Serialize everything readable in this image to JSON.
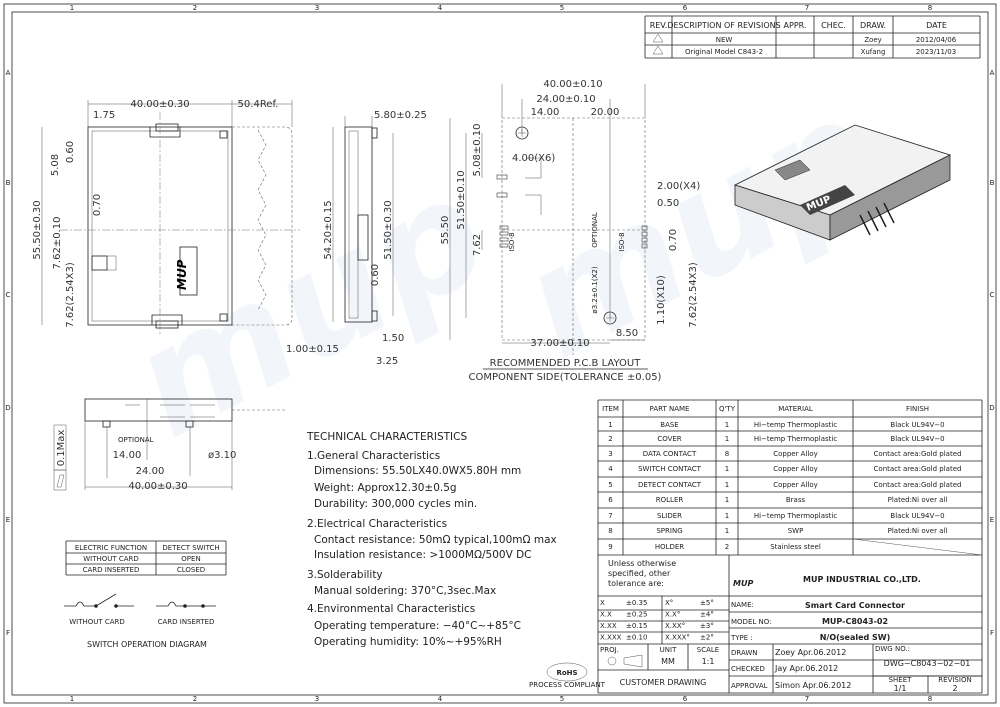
{
  "frame": {
    "columns": [
      "1",
      "2",
      "3",
      "4",
      "5",
      "6",
      "7",
      "8"
    ],
    "rows": [
      "A",
      "B",
      "C",
      "D",
      "E",
      "F"
    ]
  },
  "revisions": {
    "headers": [
      "REV.",
      "DESCRIPTION OF REVISIONS",
      "APPR.",
      "CHEC.",
      "DRAW.",
      "DATE"
    ],
    "rows": [
      {
        "rev_icon": "revision-1-triangle-icon",
        "description": "NEW",
        "appr": "",
        "chec": "",
        "draw": "Zoey",
        "date": "2012/04/06"
      },
      {
        "rev_icon": "revision-2-triangle-icon",
        "description": "Original Model C843-2",
        "appr": "",
        "chec": "",
        "draw": "Xufang",
        "date": "2023/11/03"
      }
    ]
  },
  "top_view": {
    "dims": [
      "40.00±0.30",
      "50.4Ref.",
      "1.75",
      "55.50±0.30",
      "5.08",
      "0.60",
      "0.70",
      "7.62±0.10",
      "7.62(2.54X3)"
    ],
    "logo": "MUP"
  },
  "side_view": {
    "dims": [
      "5.80±0.25",
      "54.20±0.15",
      "51.50±0.30",
      "0.60",
      "1.50",
      "1.00±0.15",
      "3.25"
    ]
  },
  "pcb_layout": {
    "dims": [
      "40.00±0.10",
      "24.00±0.10",
      "14.00",
      "20.00",
      "4.00(X6)",
      "2.00(X4)",
      "0.50",
      "55.50",
      "51.50±0.10",
      "5.08±0.10",
      "7.62",
      "OPTIONAL",
      "ø3.2±0.1(X2)",
      "ISO-8",
      "ISO-8",
      "0.70",
      "1.10(X10)",
      "7.62(2.54X3)",
      "8.50",
      "37.00±0.10"
    ],
    "caption_1": "RECOMMENDED P.C.B LAYOUT",
    "caption_2": "COMPONENT SIDE(TOLERANCE ±0.05)"
  },
  "front_view": {
    "dims": [
      "OPTIONAL",
      "14.00",
      "ø3.10",
      "24.00",
      "40.00±0.30",
      "0.1Max"
    ]
  },
  "technical": {
    "title": "TECHNICAL CHARACTERISTICS",
    "lines": [
      "1.General Characteristics",
      "Dimensions: 55.50LX40.0WX5.80H  mm",
      "Weight: Approx12.30±0.5g",
      "Durability: 300,000  cycles  min.",
      "2.Electrical Characteristics",
      "Contact resistance: 50mΩ typical,100mΩ max",
      "Insulation resistance: >1000MΩ/500V DC",
      "3.Solderability",
      "Manual soldering: 370°C,3sec.Max",
      "4.Environmental Characteristics",
      "Operating temperature: −40°C~+85°C",
      "Operating humidity: 10%~+95%RH"
    ]
  },
  "switch_table": {
    "headers": [
      "ELECTRIC FUNCTION",
      "DETECT SWITCH"
    ],
    "rows": [
      [
        "WITHOUT CARD",
        "OPEN"
      ],
      [
        "CARD INSERTED",
        "CLOSED"
      ]
    ],
    "diagram_labels": [
      "WITHOUT CARD",
      "CARD INSERTED"
    ],
    "caption": "SWITCH OPERATION DIAGRAM"
  },
  "parts": {
    "headers": [
      "ITEM",
      "PART NAME",
      "Q'TY",
      "MATERIAL",
      "FINISH"
    ],
    "rows": [
      [
        "1",
        "BASE",
        "1",
        "Hi−temp Thermoplastic",
        "Black UL94V−0"
      ],
      [
        "2",
        "COVER",
        "1",
        "Hi−temp Thermoplastic",
        "Black UL94V−0"
      ],
      [
        "3",
        "DATA CONTACT",
        "8",
        "Copper Alloy",
        "Contact area:Gold plated"
      ],
      [
        "4",
        "SWITCH CONTACT",
        "1",
        "Copper Alloy",
        "Contact area:Gold plated"
      ],
      [
        "5",
        "DETECT CONTACT",
        "1",
        "Copper Alloy",
        "Contact area:Gold plated"
      ],
      [
        "6",
        "ROLLER",
        "1",
        "Brass",
        "Plated:Ni over all"
      ],
      [
        "7",
        "SLIDER",
        "1",
        "Hi−temp Thermoplastic",
        "Black UL94V−0"
      ],
      [
        "8",
        "SPRING",
        "1",
        "SWP",
        "Plated:Ni over all"
      ],
      [
        "9",
        "HOLDER",
        "2",
        "Stainless steel",
        ""
      ]
    ]
  },
  "title_block": {
    "tolerance_note": [
      "Unless otherwise",
      "specified, other",
      "tolerance are:"
    ],
    "tolerances": [
      [
        "X",
        "±0.35",
        "X°",
        "±5°"
      ],
      [
        "X.X",
        "±0.25",
        "X.X°",
        "±4°"
      ],
      [
        "X.XX",
        "±0.15",
        "X.XX°",
        "±3°"
      ],
      [
        "X.XXX",
        "±0.10",
        "X.XXX°",
        "±2°"
      ]
    ],
    "proj_label": "PROJ.",
    "unit_label": "UNIT",
    "unit": "MM",
    "scale_label": "SCALE",
    "scale": "1:1",
    "customer_drawing": "CUSTOMER  DRAWING",
    "logo": "MUP",
    "company": "MUP INDUSTRIAL CO.,LTD.",
    "name_label": "NAME:",
    "name": "Smart Card Connector",
    "model_label": "MODEL NO:",
    "model": "MUP-C8043-02",
    "type_label": "TYPE :",
    "type": "N/O(sealed SW)",
    "drawn_label": "DRAWN",
    "drawn": "Zoey   Apr.06.2012",
    "checked_label": "CHECKED",
    "checked": "Jay   Apr.06.2012",
    "approval_label": "APPROVAL",
    "approval": "Simon  Apr.06.2012",
    "dwg_label": "DWG NO.:",
    "dwg": "DWG−C8043−02−01",
    "sheet_label": "SHEET",
    "sheet": "1/1",
    "revision_label": "REVISION",
    "revision": "2",
    "rohs": "RoHS",
    "rohs_sub": "PROCESS COMPLIANT"
  },
  "colors": {
    "line": "#222222",
    "watermark": "#dfe8f2"
  }
}
